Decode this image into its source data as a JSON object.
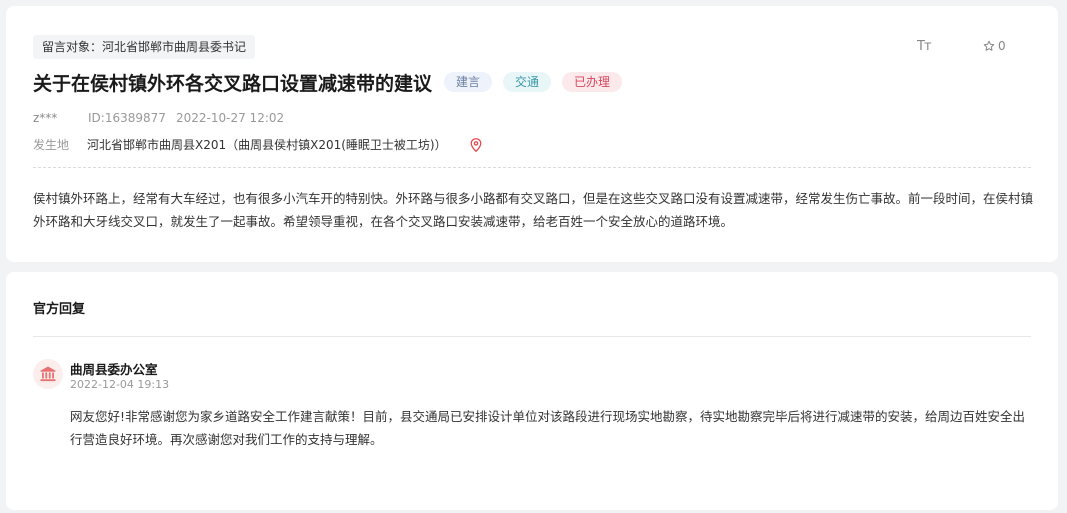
{
  "post": {
    "target_tag": "留言对象：河北省邯郸市曲周县委书记",
    "font_tool": "Tт",
    "favorite_count": "0",
    "title": "关于在侯村镇外环各交叉路口设置减速带的建议",
    "badges": [
      "建言",
      "交通",
      "已办理"
    ],
    "author": "z***",
    "id_text": "ID:16389877",
    "datetime": "2022-10-27 12:02",
    "location_label": "发生地",
    "location_value": "河北省邯郸市曲周县X201（曲周县侯村镇X201(睡眠卫士被工坊)）",
    "body": "侯村镇外环路上，经常有大车经过，也有很多小汽车开的特别快。外环路与很多小路都有交叉路口，但是在这些交叉路口没有设置减速带，经常发生伤亡事故。前一段时间，在侯村镇外环路和大牙线交叉口，就发生了一起事故。希望领导重视，在各个交叉路口安装减速带，给老百姓一个安全放心的道路环境。"
  },
  "reply": {
    "heading": "官方回复",
    "author": "曲周县委办公室",
    "datetime": "2022-12-04 19:13",
    "body": "网友您好!非常感谢您为家乡道路安全工作建言献策！目前，县交通局已安排设计单位对该路段进行现场实地勘察，待实地勘察完毕后将进行减速带的安装，给周边百姓安全出行营造良好环境。再次感谢您对我们工作的支持与理解。"
  },
  "icons": {
    "font_size": "font-size-icon",
    "favorite": "star-icon",
    "location": "location-pin-icon",
    "avatar": "government-building-icon"
  },
  "colors": {
    "page_bg": "#f2f3f5",
    "badge_suggest": "#6b7fa3",
    "badge_traffic": "#3a98a8",
    "badge_done": "#d9485f",
    "pin": "#e5484d"
  }
}
